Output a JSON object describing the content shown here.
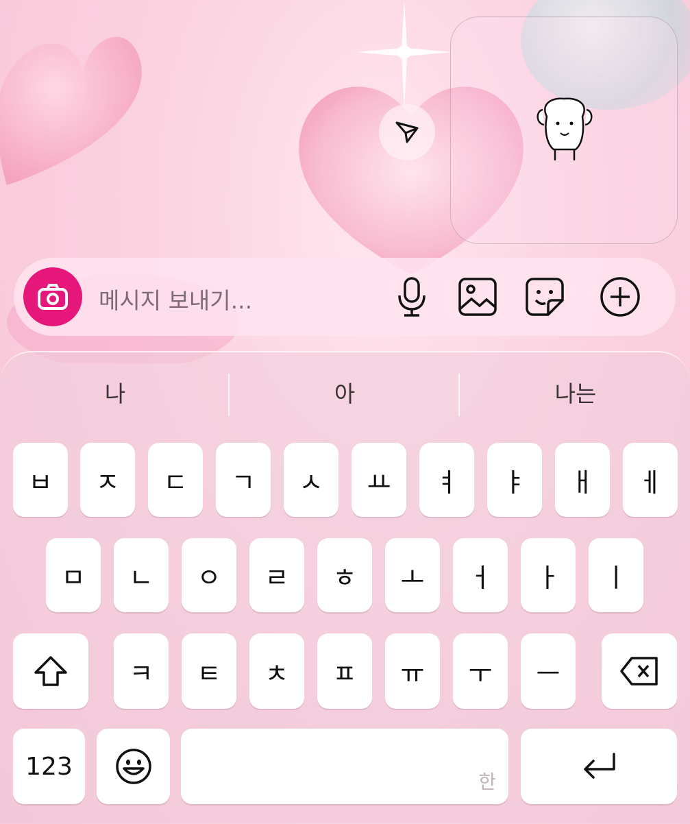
{
  "send_button": {
    "icon": "send-icon"
  },
  "sticker_preview": {
    "icon": "dog-sticker-icon"
  },
  "message_bar": {
    "camera_icon": "camera-icon",
    "placeholder": "메시지 보내기...",
    "icons": [
      "microphone-icon",
      "gallery-icon",
      "sticker-icon",
      "add-icon"
    ]
  },
  "keyboard": {
    "suggestions": [
      "나",
      "아",
      "나는"
    ],
    "row1": [
      "ㅂ",
      "ㅈ",
      "ㄷ",
      "ㄱ",
      "ㅅ",
      "ㅛ",
      "ㅕ",
      "ㅑ",
      "ㅐ",
      "ㅔ"
    ],
    "row2": [
      "ㅁ",
      "ㄴ",
      "ㅇ",
      "ㄹ",
      "ㅎ",
      "ㅗ",
      "ㅓ",
      "ㅏ",
      "ㅣ"
    ],
    "row3": [
      "ㅋ",
      "ㅌ",
      "ㅊ",
      "ㅍ",
      "ㅠ",
      "ㅜ",
      "ㅡ"
    ],
    "numbers_label": "123",
    "space_hint": "한",
    "shift_icon": "shift-icon",
    "backspace_icon": "backspace-icon",
    "emoji_icon": "emoji-icon",
    "return_icon": "return-icon"
  },
  "colors": {
    "accent": "#e6177a",
    "background": "#f7c3d6"
  }
}
